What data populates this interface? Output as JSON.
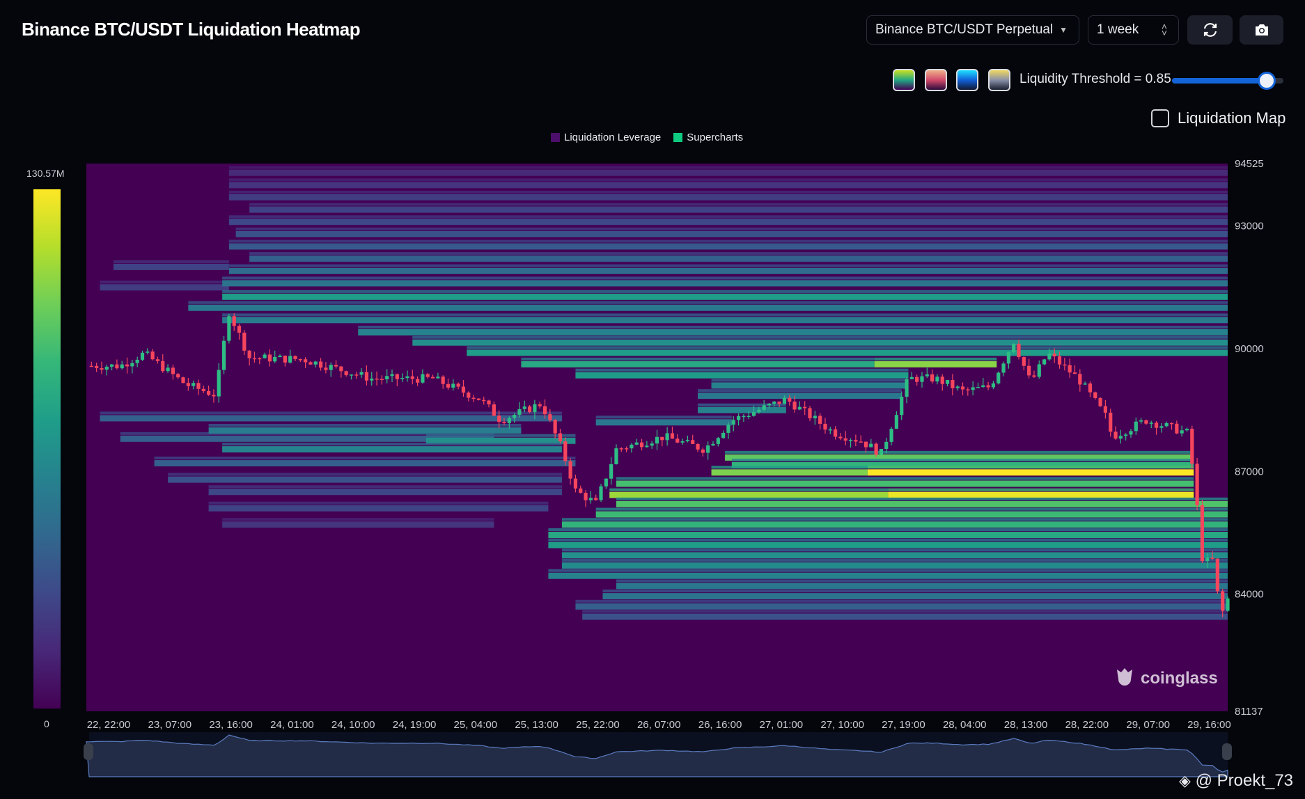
{
  "header": {
    "title": "Binance BTC/USDT Liquidation Heatmap"
  },
  "controls": {
    "market": "Binance BTC/USDT Perpetual",
    "period": "1 week",
    "refresh_icon": "refresh-icon",
    "camera_icon": "camera-icon",
    "palettes": [
      {
        "name": "viridis",
        "colors": [
          "#c8e020",
          "#22a884",
          "#440154"
        ]
      },
      {
        "name": "magma",
        "colors": [
          "#f0b08a",
          "#d04a6a",
          "#2a0a3a"
        ]
      },
      {
        "name": "blue",
        "colors": [
          "#1ee0ff",
          "#1160d8",
          "#101830"
        ]
      },
      {
        "name": "cividis",
        "colors": [
          "#f0d860",
          "#8a90a8",
          "#1a2030"
        ]
      }
    ],
    "threshold_label": "Liquidity Threshold = 0.85",
    "threshold_value": 0.85,
    "liquidation_map_label": "Liquidation Map",
    "liquidation_map_checked": false
  },
  "legend": [
    {
      "label": "Liquidation Leverage",
      "color": "#4b0f6b"
    },
    {
      "label": "Supercharts",
      "color": "#0ecb81"
    }
  ],
  "color_scale": {
    "max_label": "130.57M",
    "min_label": "0"
  },
  "watermark": "coinglass",
  "author": "@ Proekt_73",
  "chart_data": {
    "type": "heatmap",
    "title": "Binance BTC/USDT Liquidation Heatmap",
    "y_ticks": [
      "94525",
      "93000",
      "90000",
      "87000",
      "84000",
      "81137"
    ],
    "y_tick_values": [
      94525,
      93000,
      90000,
      87000,
      84000,
      81137
    ],
    "ylim": [
      81137,
      94525
    ],
    "x_hours": 168,
    "x_ticks": [
      "22, 22:00",
      "23, 07:00",
      "23, 16:00",
      "24, 01:00",
      "24, 10:00",
      "24, 19:00",
      "25, 04:00",
      "25, 13:00",
      "25, 22:00",
      "26, 07:00",
      "26, 16:00",
      "27, 01:00",
      "27, 10:00",
      "27, 19:00",
      "28, 04:00",
      "28, 13:00",
      "28, 22:00",
      "29, 07:00",
      "29, 16:00"
    ],
    "price_path": [
      [
        0,
        89580
      ],
      [
        5,
        89580
      ],
      [
        8.5,
        89885
      ],
      [
        14.6,
        89130
      ],
      [
        19,
        88870
      ],
      [
        21,
        90900
      ],
      [
        24,
        89780
      ],
      [
        32,
        89740
      ],
      [
        42,
        89270
      ],
      [
        51,
        89270
      ],
      [
        58,
        88765
      ],
      [
        61,
        88250
      ],
      [
        67,
        88660
      ],
      [
        70,
        87540
      ],
      [
        72,
        86530
      ],
      [
        75,
        86220
      ],
      [
        78,
        87540
      ],
      [
        85,
        87850
      ],
      [
        91,
        87540
      ],
      [
        95,
        88250
      ],
      [
        103,
        88765
      ],
      [
        110,
        87950
      ],
      [
        114,
        87750
      ],
      [
        117,
        87440
      ],
      [
        121,
        89270
      ],
      [
        125,
        89270
      ],
      [
        129,
        88960
      ],
      [
        133,
        89070
      ],
      [
        136.5,
        90190
      ],
      [
        139,
        89170
      ],
      [
        141.5,
        89885
      ],
      [
        146,
        89270
      ],
      [
        150,
        88360
      ],
      [
        151,
        87850
      ],
      [
        156,
        88250
      ],
      [
        162,
        87950
      ],
      [
        163,
        86930
      ],
      [
        164.5,
        84490
      ],
      [
        165.5,
        85100
      ],
      [
        167,
        83475
      ],
      [
        168,
        83880
      ]
    ],
    "bands": [
      [
        92000,
        4,
        21,
        0.2
      ],
      [
        91500,
        2,
        21,
        0.18
      ],
      [
        88300,
        2,
        70,
        0.3
      ],
      [
        87800,
        5,
        60,
        0.3
      ],
      [
        87200,
        10,
        72,
        0.3
      ],
      [
        86800,
        12,
        70,
        0.25
      ],
      [
        86500,
        18,
        70,
        0.22
      ],
      [
        86100,
        18,
        68,
        0.2
      ],
      [
        85700,
        20,
        60,
        0.15
      ],
      [
        94300,
        21,
        168,
        0.12
      ],
      [
        94000,
        21,
        168,
        0.15
      ],
      [
        93700,
        21,
        168,
        0.18
      ],
      [
        93400,
        24,
        168,
        0.2
      ],
      [
        93100,
        21,
        168,
        0.22
      ],
      [
        92800,
        22,
        168,
        0.25
      ],
      [
        92500,
        21,
        168,
        0.28
      ],
      [
        92200,
        24,
        168,
        0.3
      ],
      [
        91900,
        21,
        168,
        0.35
      ],
      [
        91600,
        20,
        168,
        0.38
      ],
      [
        91270,
        20,
        168,
        0.55
      ],
      [
        91000,
        15,
        168,
        0.4
      ],
      [
        90700,
        20,
        168,
        0.42
      ],
      [
        90400,
        40,
        168,
        0.45
      ],
      [
        90150,
        48,
        168,
        0.5
      ],
      [
        89900,
        56,
        168,
        0.55
      ],
      [
        89620,
        64,
        116,
        0.6
      ],
      [
        89620,
        116,
        134,
        0.82
      ],
      [
        89350,
        72,
        121,
        0.55
      ],
      [
        89100,
        92,
        121,
        0.45
      ],
      [
        88850,
        90,
        120,
        0.4
      ],
      [
        88500,
        90,
        103,
        0.45
      ],
      [
        88200,
        75,
        95,
        0.4
      ],
      [
        88000,
        18,
        64,
        0.42
      ],
      [
        87750,
        50,
        72,
        0.5
      ],
      [
        87540,
        20,
        70,
        0.45
      ],
      [
        87340,
        94,
        163,
        0.75
      ],
      [
        87150,
        95,
        163,
        0.65
      ],
      [
        86975,
        92,
        115,
        0.8
      ],
      [
        86975,
        115,
        163,
        1.0
      ],
      [
        86700,
        78,
        163,
        0.7
      ],
      [
        86425,
        77,
        118,
        0.85
      ],
      [
        86425,
        118,
        163,
        0.97
      ],
      [
        86200,
        78,
        168,
        0.72
      ],
      [
        85950,
        75,
        168,
        0.68
      ],
      [
        85700,
        70,
        168,
        0.65
      ],
      [
        85450,
        68,
        168,
        0.6
      ],
      [
        85200,
        68,
        168,
        0.55
      ],
      [
        84950,
        70,
        168,
        0.5
      ],
      [
        84700,
        70,
        168,
        0.48
      ],
      [
        84450,
        68,
        168,
        0.45
      ],
      [
        84200,
        78,
        168,
        0.4
      ],
      [
        83950,
        76,
        168,
        0.38
      ],
      [
        83700,
        72,
        168,
        0.3
      ],
      [
        83450,
        73,
        168,
        0.25
      ]
    ],
    "candle_colors": {
      "up": "#2ebd85",
      "down": "#f6465d"
    }
  }
}
